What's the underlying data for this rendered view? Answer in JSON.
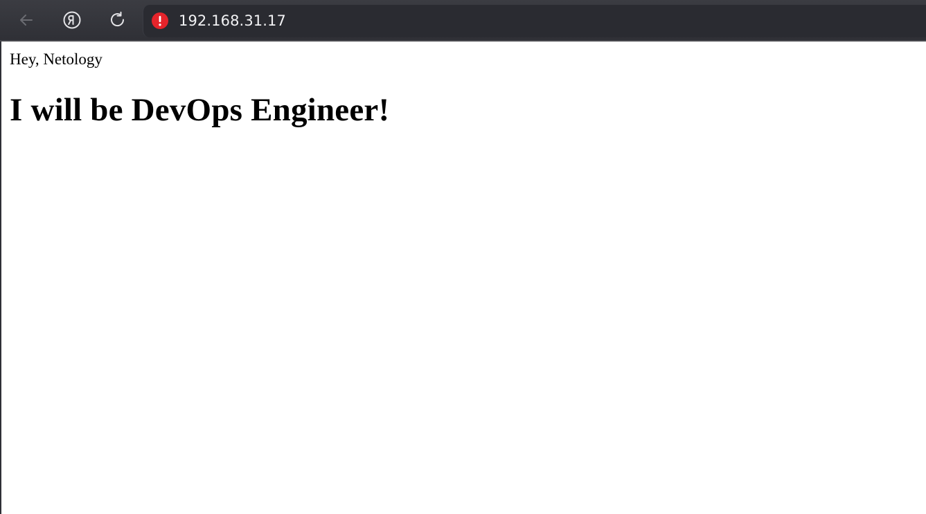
{
  "browser": {
    "url": "192.168.31.17",
    "security_state": "warning-icon",
    "buttons": {
      "back": "back-arrow-icon",
      "home": "yandex-logo-icon",
      "reload": "reload-icon"
    },
    "colors": {
      "toolbar": "#2f3036",
      "warning": "#e5242b",
      "url_text": "#f2f2f4"
    }
  },
  "page": {
    "greeting": "Hey, Netology",
    "headline": "I will be DevOps Engineer!"
  }
}
